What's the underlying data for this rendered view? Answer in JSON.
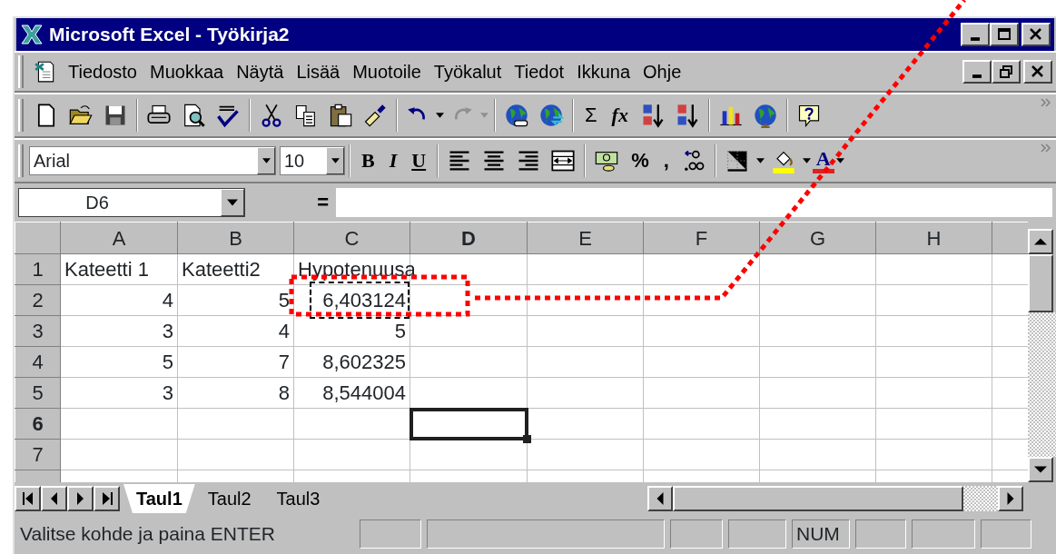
{
  "window": {
    "title": "Microsoft Excel - Työkirja2"
  },
  "menu_bar": [
    {
      "label": "Tiedosto"
    },
    {
      "label": "Muokkaa"
    },
    {
      "label": "Näytä"
    },
    {
      "label": "Lisää"
    },
    {
      "label": "Muotoile"
    },
    {
      "label": "Työkalut"
    },
    {
      "label": "Tiedot"
    },
    {
      "label": "Ikkuna"
    },
    {
      "label": "Ohje"
    }
  ],
  "standard_toolbar": {
    "sum": "Σ",
    "function": "fx",
    "undo_disabled": false,
    "redo_disabled": true
  },
  "formatting_toolbar": {
    "font": "Arial",
    "font_size": "10",
    "bold": "B",
    "italic": "I",
    "underline": "U",
    "percent": "%",
    "comma": ",",
    "font_color": "A"
  },
  "formula_bar": {
    "name_box": "D6",
    "equals": "="
  },
  "sheet": {
    "columns": [
      {
        "label": "A",
        "selected": false
      },
      {
        "label": "B",
        "selected": false
      },
      {
        "label": "C",
        "selected": false
      },
      {
        "label": "D",
        "selected": true
      },
      {
        "label": "E",
        "selected": false
      },
      {
        "label": "F",
        "selected": false
      },
      {
        "label": "G",
        "selected": false
      },
      {
        "label": "H",
        "selected": false
      }
    ],
    "rows": [
      {
        "header": "1",
        "selected": false,
        "kind": "text",
        "cells": [
          {
            "text": "Kateetti 1",
            "marquee": false
          },
          {
            "text": "Kateetti2",
            "marquee": false
          },
          {
            "text": "Hypotenuusa",
            "marquee": false
          }
        ]
      },
      {
        "header": "2",
        "selected": false,
        "kind": "number",
        "cells": [
          {
            "text": "4",
            "marquee": false
          },
          {
            "text": "5",
            "marquee": false
          },
          {
            "text": "6,403124",
            "marquee": true
          }
        ]
      },
      {
        "header": "3",
        "selected": false,
        "kind": "number",
        "cells": [
          {
            "text": "3",
            "marquee": false
          },
          {
            "text": "4",
            "marquee": false
          },
          {
            "text": "5",
            "marquee": false
          }
        ]
      },
      {
        "header": "4",
        "selected": false,
        "kind": "number",
        "cells": [
          {
            "text": "5",
            "marquee": false
          },
          {
            "text": "7",
            "marquee": false
          },
          {
            "text": "8,602325",
            "marquee": false
          }
        ]
      },
      {
        "header": "5",
        "selected": false,
        "kind": "number",
        "cells": [
          {
            "text": "3",
            "marquee": false
          },
          {
            "text": "8",
            "marquee": false
          },
          {
            "text": "8,544004",
            "marquee": false
          }
        ]
      },
      {
        "header": "6",
        "selected": true,
        "kind": "empty"
      },
      {
        "header": "7",
        "selected": false,
        "kind": "empty"
      }
    ]
  },
  "sheet_tabs": [
    {
      "label": "Taul1",
      "selected": true
    },
    {
      "label": "Taul2",
      "selected": false
    },
    {
      "label": "Taul3",
      "selected": false
    }
  ],
  "status_bar": {
    "message": "Valitse kohde ja paina ENTER",
    "num_indicator": "NUM"
  }
}
